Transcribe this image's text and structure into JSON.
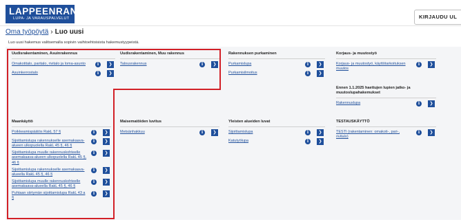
{
  "header": {
    "logo_main": "LAPPEENRANTA",
    "logo_sub": "LUPA- JA VARAUSPALVELUT",
    "login_label": "KIRJAUDU UL"
  },
  "breadcrumb": {
    "home": "Oma työpöytä",
    "separator": "›",
    "current": "Luo uusi"
  },
  "subtitle": "Luo uusi hakemus valitsemalla sopivin vaihtoehtoisista hakemustyypeistä.",
  "categories": [
    {
      "title": "Uudisrakentaminen, Asuinrakennus",
      "items": [
        "Omakotitalo, paritalo, rivitalo ja loma-asunto",
        "Asuinkerrostalo"
      ]
    },
    {
      "title": "Uudisrakentaminen, Muu rakennus",
      "items": [
        "Talousrakennus"
      ]
    },
    {
      "title": "Rakennuksen purkaminen",
      "items": [
        "Purkamislupa",
        "Purkamisilmoitus"
      ]
    },
    {
      "title": "Korjaus- ja muutostyö",
      "items": [
        "Korjaus- ja muutostyö, käyttötarkoituksen muutos"
      ]
    },
    {
      "title": "Ennen 1.1.2025 haettujen lupien jatko- ja muutoslupahakemukset",
      "items": [
        "Rakennuslupa"
      ]
    },
    {
      "title": "Maankäyttö",
      "items": [
        "Poikkeamispäätös RakL 57 §",
        "Sijoittamislupa rakennukselle asemakaava-alueen ulkopuolella RakL 45 §, 46 §",
        "Sijoittamislupa muulle rakennuskohteelle asemakaava-alueen ulkopuolella RakL 45 §, 46 §",
        "Sijoittamislupa rakennukselle asemakaava-alueella RakL 45 §, 46 §",
        "Sijoittamislupa muulle rakennuskohteelle asemakaava-alueella RakL 45 §, 46 §",
        "Puhtaan siirtymän sijoittamislupa RakL 43 a §"
      ]
    },
    {
      "title": "Maisematöiden luvitus",
      "items": [
        "Metsänhakkuu"
      ]
    },
    {
      "title": "Yleisten alueiden luvat",
      "items": [
        "Sijoittamislupa",
        "Katutyölupa"
      ]
    },
    {
      "title": "TESTAUSKÄYTTÖ",
      "items": [
        "TESTI (rakentaminen: omakoti-, pari-, rivitalo)"
      ]
    }
  ],
  "icons": {
    "info": "info-icon",
    "go": "arrow-right-icon"
  },
  "colors": {
    "brand": "#1f4f9b",
    "highlight": "#d21f26",
    "panel_bg": "#f4f5f7"
  }
}
